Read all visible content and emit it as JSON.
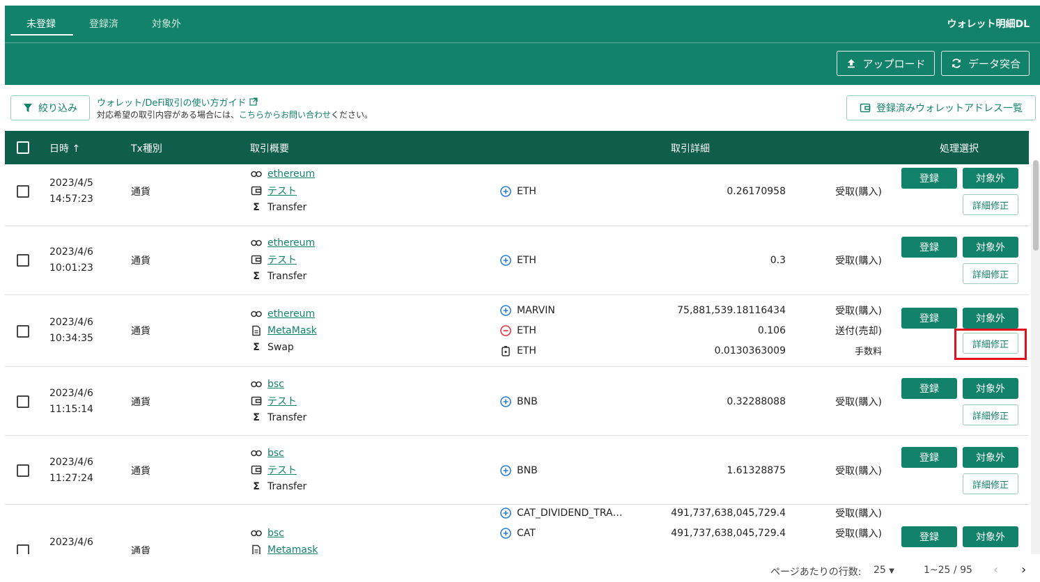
{
  "tabs": [
    "未登録",
    "登録済",
    "対象外"
  ],
  "wallet_dl": "ウォレット明細DL",
  "upload_label": "アップロード",
  "reconcile_label": "データ突合",
  "filter_label": "絞り込み",
  "guide_link": "ウォレット/DeFi取引の使い方ガイド",
  "note_prefix": "対応希望の取引内容がある場合には、",
  "note_link": "こちらからお問い合わせ",
  "note_suffix": "ください。",
  "address_list_label": "登録済みウォレットアドレス一覧",
  "headers": {
    "date": "日時",
    "txtype": "Tx種別",
    "summary": "取引概要",
    "detail": "取引詳細",
    "action": "処理選択"
  },
  "rows": [
    {
      "date": "2023/4/5",
      "time": "14:57:23",
      "txtype": "通貨",
      "chain": "ethereum",
      "wallet": "テスト",
      "wallet_icon": "wallet-icon",
      "method": "Transfer",
      "details": [
        {
          "icon": "plus",
          "asset": "ETH",
          "amount": "0.26170958",
          "kind": "受取(購入)"
        }
      ]
    },
    {
      "date": "2023/4/6",
      "time": "10:01:23",
      "txtype": "通貨",
      "chain": "ethereum",
      "wallet": "テスト",
      "wallet_icon": "wallet-icon",
      "method": "Transfer",
      "details": [
        {
          "icon": "plus",
          "asset": "ETH",
          "amount": "0.3",
          "kind": "受取(購入)"
        }
      ]
    },
    {
      "date": "2023/4/6",
      "time": "10:34:35",
      "txtype": "通貨",
      "chain": "ethereum",
      "wallet": "MetaMask",
      "wallet_icon": "document-icon",
      "method": "Swap",
      "details": [
        {
          "icon": "plus",
          "asset": "MARVIN",
          "amount": "75,881,539.18116434",
          "kind": "受取(購入)"
        },
        {
          "icon": "minus",
          "asset": "ETH",
          "amount": "0.106",
          "kind": "送付(売却)"
        },
        {
          "icon": "fee",
          "asset": "ETH",
          "amount": "0.0130363009",
          "kind": "手数料"
        }
      ]
    },
    {
      "date": "2023/4/6",
      "time": "11:15:14",
      "txtype": "通貨",
      "chain": "bsc",
      "wallet": "テスト",
      "wallet_icon": "wallet-icon",
      "method": "Transfer",
      "details": [
        {
          "icon": "plus",
          "asset": "BNB",
          "amount": "0.32288088",
          "kind": "受取(購入)"
        }
      ]
    },
    {
      "date": "2023/4/6",
      "time": "11:27:24",
      "txtype": "通貨",
      "chain": "bsc",
      "wallet": "テスト",
      "wallet_icon": "wallet-icon",
      "method": "Transfer",
      "details": [
        {
          "icon": "plus",
          "asset": "BNB",
          "amount": "1.61328875",
          "kind": "受取(購入)"
        }
      ]
    },
    {
      "date": "2023/4/6",
      "time": "",
      "txtype": "通貨",
      "chain": "bsc",
      "wallet": "Metamask",
      "wallet_icon": "document-icon",
      "method": "",
      "details": [
        {
          "icon": "plus",
          "asset": "CAT_DIVIDEND_TRA…",
          "amount": "491,737,638,045,729.4",
          "kind": "受取(購入)"
        },
        {
          "icon": "plus",
          "asset": "CAT",
          "amount": "491,737,638,045,729.4",
          "kind": "受取(購入)"
        }
      ]
    }
  ],
  "actions": {
    "register": "登録",
    "exclude": "対象外",
    "edit": "詳細修正"
  },
  "footer": {
    "rows_per_page_label": "ページあたりの行数:",
    "rows_per_page": "25",
    "range": "1~25 / 95"
  },
  "colors": {
    "brand": "#12836a",
    "header": "#0f5d4b",
    "minus": "#e0363d",
    "plus": "#2a7fd4",
    "highlight": "#e0101e"
  }
}
